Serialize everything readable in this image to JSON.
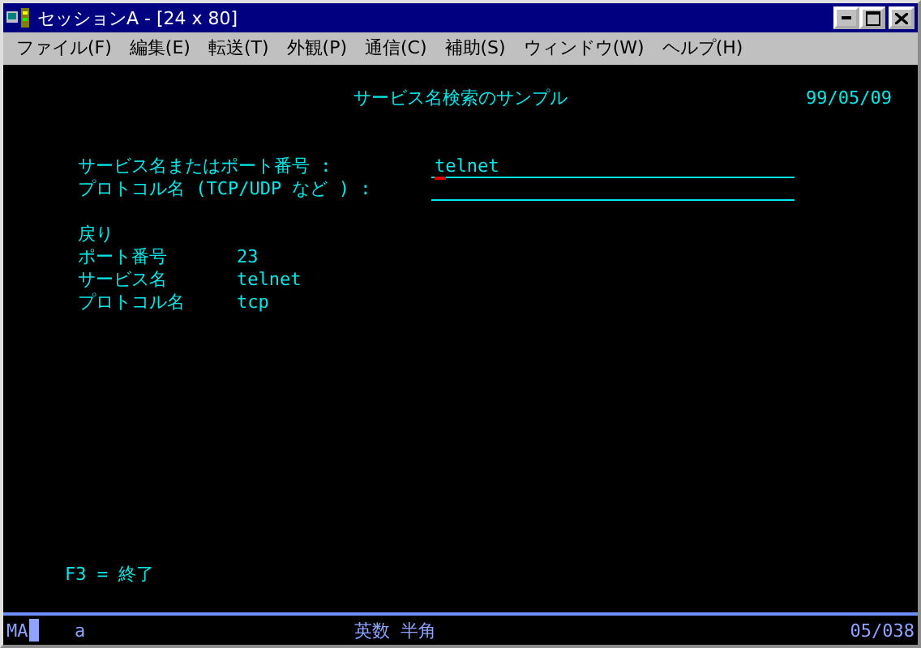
{
  "window": {
    "title": "セッションA - [24 x 80]"
  },
  "menu": [
    "ファイル(F)",
    "編集(E)",
    "転送(T)",
    "外観(P)",
    "通信(C)",
    "補助(S)",
    "ウィンドウ(W)",
    "ヘルプ(H)"
  ],
  "screen": {
    "title": "サービス名検索のサンプル",
    "date": "99/05/09",
    "fields": [
      {
        "label": "サービス名またはポート番号 :",
        "value": "telnet"
      },
      {
        "label": "プロトコル名 (TCP/UDP など ) :"
      }
    ],
    "result_heading": "戻り",
    "results": [
      {
        "label": "ポート番号",
        "value": "23"
      },
      {
        "label": "サービス名",
        "value": "telnet"
      },
      {
        "label": "プロトコル名",
        "value": "tcp"
      }
    ],
    "function_key": "F3 = 終了"
  },
  "status_bar": {
    "mode": "MA",
    "input": "a",
    "ime": "英数 半角",
    "position": "05/038"
  }
}
